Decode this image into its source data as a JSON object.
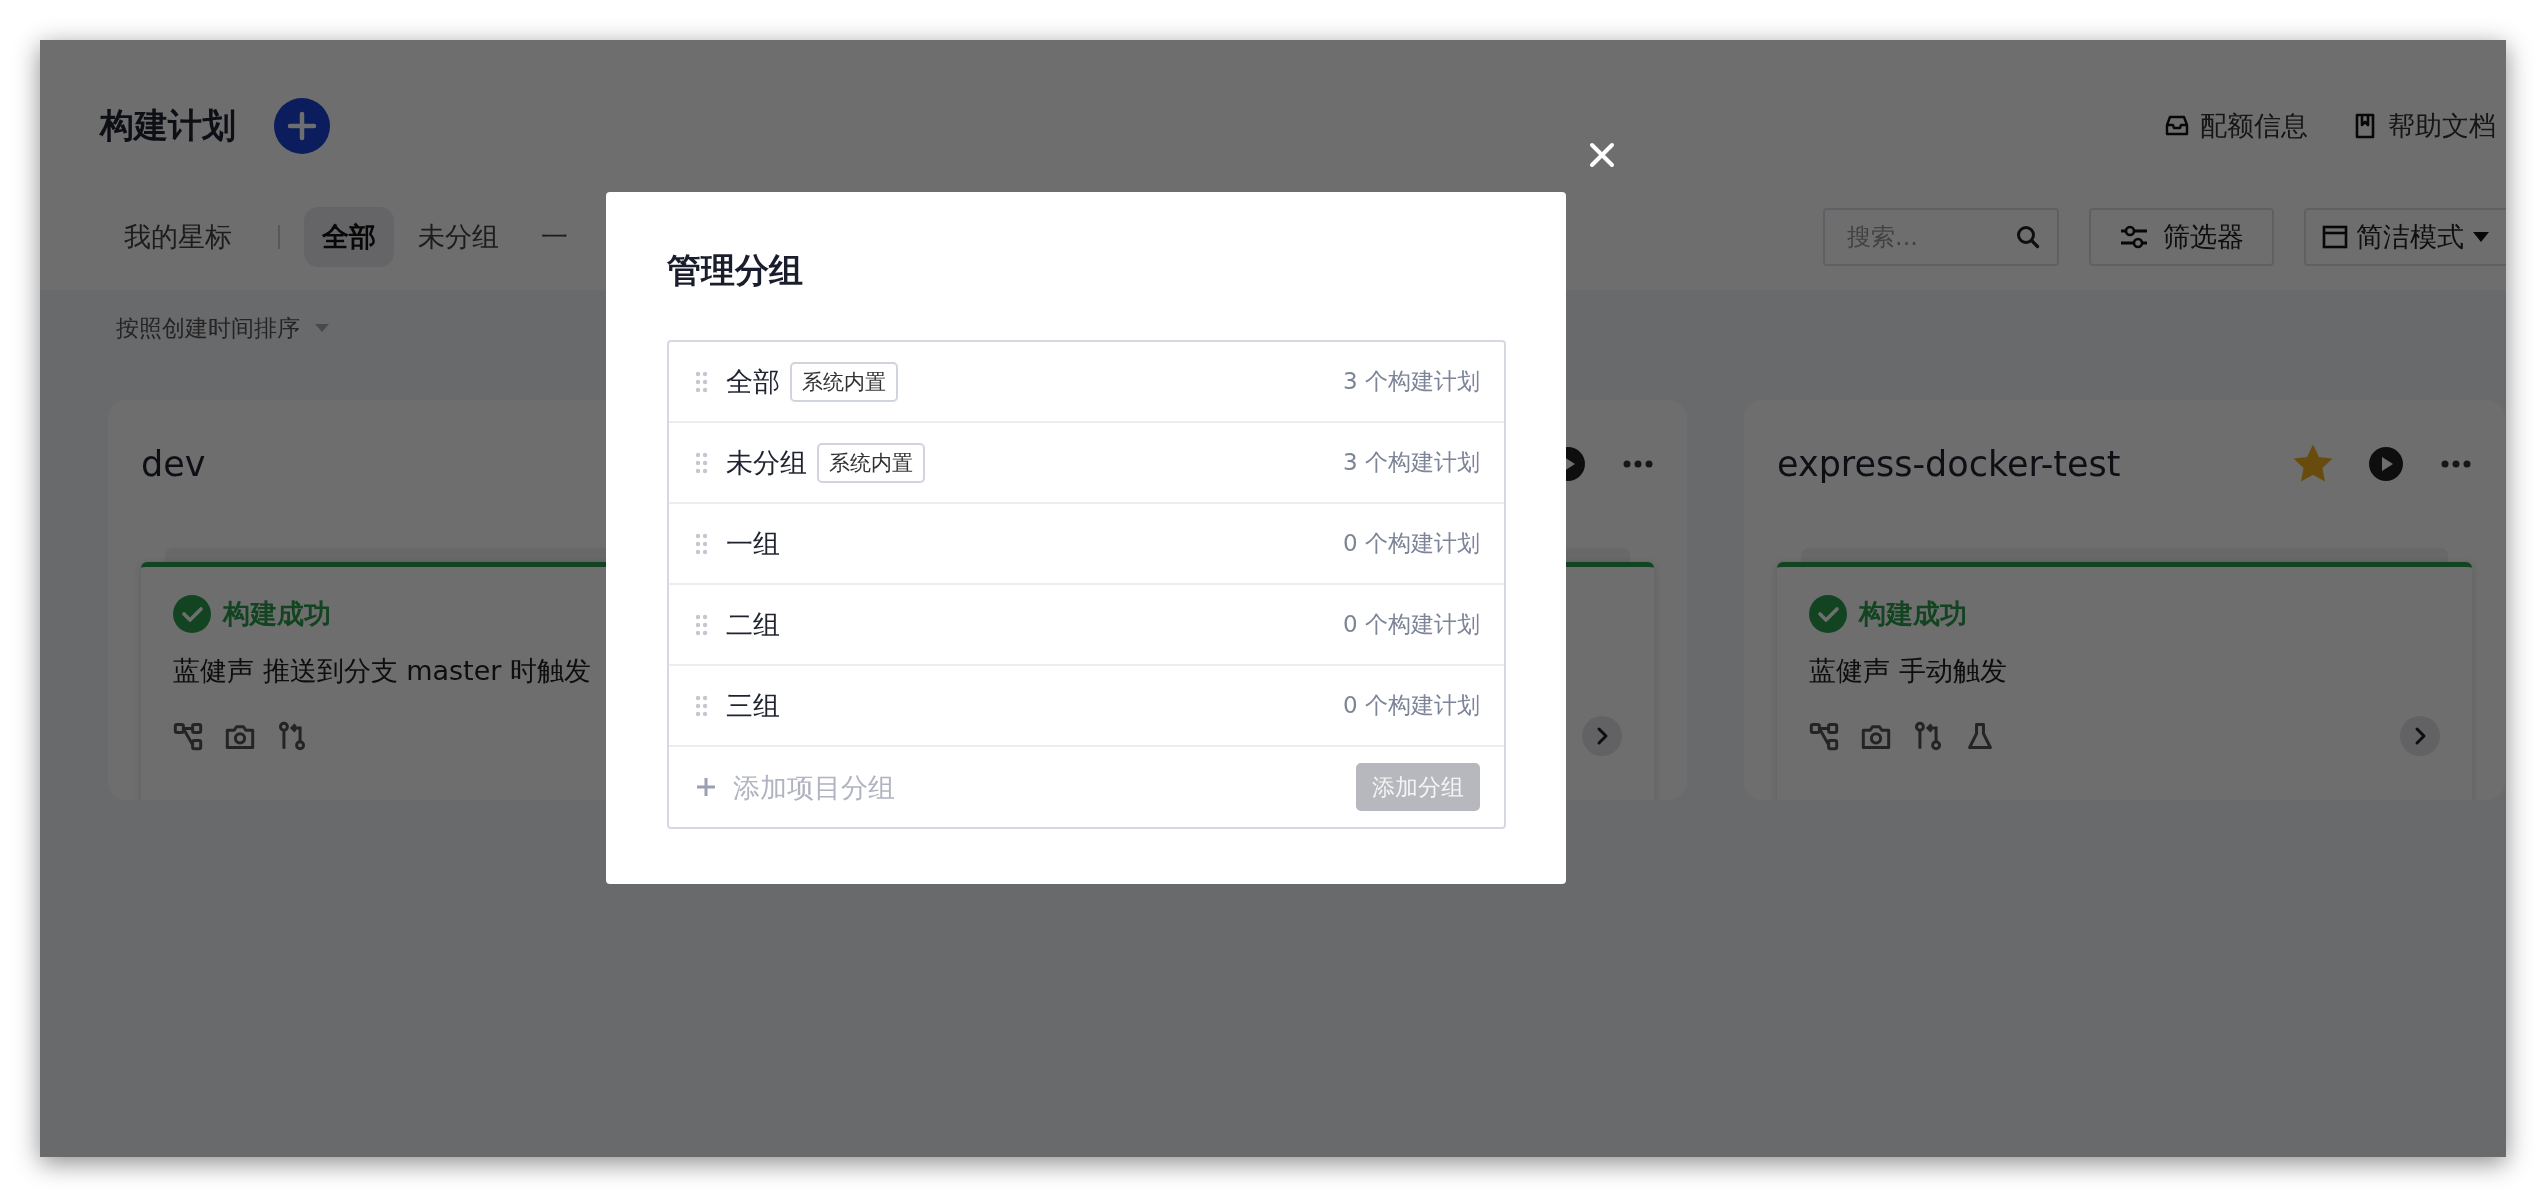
{
  "page": {
    "title": "构建计划",
    "links": [
      "配额信息",
      "帮助文档"
    ]
  },
  "tabs": [
    {
      "label": "我的星标",
      "selected": false
    },
    {
      "label": "全部",
      "selected": true
    },
    {
      "label": "未分组",
      "selected": false
    },
    {
      "label": "一",
      "selected": false
    }
  ],
  "search": {
    "placeholder": "搜索..."
  },
  "filter_button": "筛选器",
  "view_mode": "简洁模式",
  "sort": "按照创建时间排序",
  "cards": [
    {
      "kind": "plan",
      "title": "dev",
      "status": "构建成功",
      "trigger": "蓝健声 推送到分支 master 时触发",
      "test_stage": false
    },
    {
      "kind": "covered"
    },
    {
      "kind": "plan",
      "title": "express-docker-test",
      "starred": true,
      "status": "构建成功",
      "trigger": "蓝健声 手动触发",
      "test_stage": true
    }
  ],
  "dialog": {
    "title": "管理分组",
    "groups": [
      {
        "name": "全部",
        "tag": "系统内置",
        "count": "3 个构建计划"
      },
      {
        "name": "未分组",
        "tag": "系统内置",
        "count": "3 个构建计划"
      },
      {
        "name": "一组",
        "count": "0 个构建计划"
      },
      {
        "name": "二组",
        "count": "0 个构建计划"
      },
      {
        "name": "三组",
        "count": "0 个构建计划"
      }
    ],
    "new_group": {
      "placeholder": "添加项目分组"
    },
    "add_button": {
      "label": "添加分组",
      "disabled": true
    }
  }
}
